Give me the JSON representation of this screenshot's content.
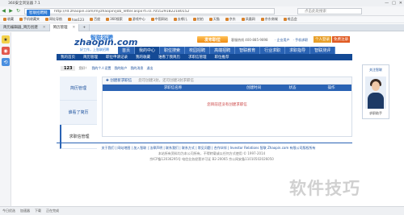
{
  "browser": {
    "title": "360安全浏览器 7.1",
    "window_controls": [
      "—",
      "□",
      "✕"
    ],
    "site_badge": "智联招聘网",
    "url": "http://rd.zhaopin.com/myzhaopin/job_letter.aspx?t=0.7055291822180152",
    "search_placeholder": "点击此处搜索",
    "bookmarks": [
      "收藏",
      "手机收藏夹",
      "网址导航",
      "hao123",
      "百度",
      "360搜索",
      "游戏中心",
      "中国网站",
      "去哪儿",
      "拍拍",
      "天猫",
      "京东",
      "凤凰网",
      "京东商城",
      "唯品会"
    ],
    "tabs": [
      {
        "label": "简历编辑器_简历创建"
      },
      {
        "label": "简历管理"
      }
    ],
    "status_text": [
      "今日优选",
      "加速器",
      "下载",
      "正在完成"
    ]
  },
  "site": {
    "logo_text": "zhaopin.com",
    "logo_cn": "智联招聘",
    "slogan": "好工作，上智联招聘",
    "post_job_label": "发布职位",
    "service_tel": "客服热线 400-885-9898",
    "top_links": [
      "· 企业用户",
      "· 手机求职"
    ],
    "personal_label": "个人登录",
    "company_label": "免费注册",
    "main_nav": [
      "首页",
      "我的中心",
      "职位搜索",
      "校园招聘",
      "高端招聘",
      "智联教育",
      "行业求职",
      "求职指导",
      "智联测评"
    ],
    "main_nav_active": 1,
    "sub_nav": [
      "我的首页",
      "简历管理",
      "职位申请记录",
      "我的收藏",
      "谁看了我简历",
      "求职信管理",
      "职位推荐"
    ],
    "user": {
      "name": "123",
      "greeting": "您好！",
      "links": [
        "我的个人设置",
        "我的账户",
        "我的消息",
        "退出"
      ]
    },
    "left_menu": [
      "简历管理",
      "谁看了简历",
      "求职信管理"
    ],
    "left_menu_active": 2,
    "toolbar": {
      "new_letter": "创建新求职信",
      "note": "您可创建3封，还可创建3封求职信"
    },
    "table_headers": [
      "",
      "求职信名称",
      "创建时间",
      "状态",
      "操作"
    ],
    "empty_message": "您目前还没有创建求职信",
    "qr": {
      "label": "关注智联",
      "name": "求职助手"
    },
    "footer_links": "关于我们 | 网站地图 | 加入智联 | 法律声明 | 联系我们 | 联系方式 | 常见问题 | 合作伙伴 | Investor Relations 智联 Zhaopin.com 有限公司版权所有",
    "footer_line2": "本站所有资料均为本公司所有，不得转载或以任何方式使用 © 1997-2014",
    "footer_line3": "京ICP备12036295号  电信业务经营许可证 B2-20065 京公网安备11010502026050"
  },
  "watermark_text": "软件技巧"
}
